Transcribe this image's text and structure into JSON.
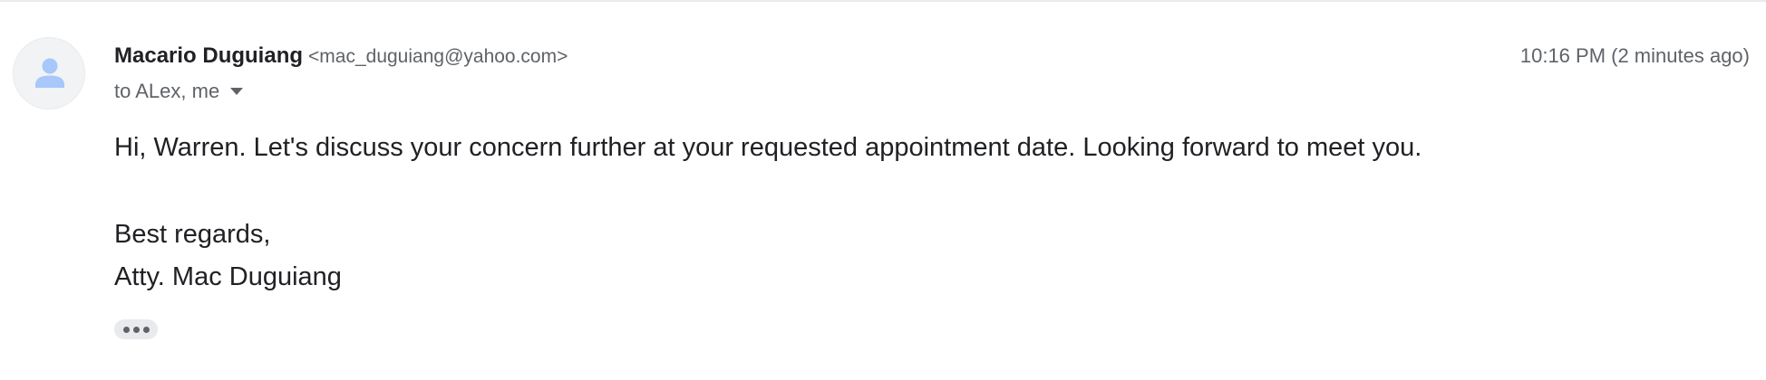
{
  "message": {
    "sender": {
      "name": "Macario Duguiang",
      "email": "<mac_duguiang@yahoo.com>",
      "avatar_icon": "person-icon",
      "avatar_color": "#a8c7fa"
    },
    "timestamp": "10:16 PM (2 minutes ago)",
    "recipients": "to ALex, me",
    "body": {
      "greeting": "Hi, Warren. Let's discuss your concern further at your requested appointment date. Looking forward to meet you.",
      "closing": "Best regards,",
      "signature": "Atty. Mac Duguiang"
    },
    "expand_icon": "more-horizontal-icon"
  }
}
